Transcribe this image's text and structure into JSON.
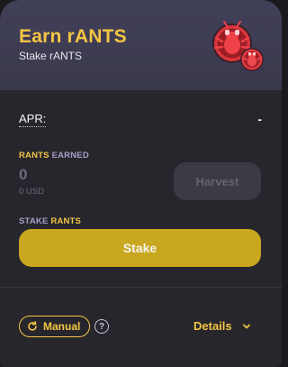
{
  "header": {
    "title": "Earn rANTS",
    "subtitle": "Stake rANTS",
    "logo_icon": "ant-token-pair-icon"
  },
  "apr": {
    "label": "APR:",
    "value": "-"
  },
  "earned": {
    "label_token": "RANTS",
    "label_word": "EARNED",
    "amount": "0",
    "usd": "0 USD",
    "harvest_label": "Harvest"
  },
  "stake": {
    "label_word": "STAKE",
    "label_token": "RANTS",
    "button_label": "Stake"
  },
  "footer": {
    "manual_label": "Manual",
    "manual_icon": "refresh-icon",
    "help_glyph": "?",
    "details_label": "Details",
    "details_icon": "chevron-down-icon"
  },
  "colors": {
    "accent": "#f3c544",
    "stake_button": "#c9a71e",
    "card_bg": "#27262c",
    "header_bg": "#3d3c50",
    "muted_label": "#a79ec9"
  }
}
